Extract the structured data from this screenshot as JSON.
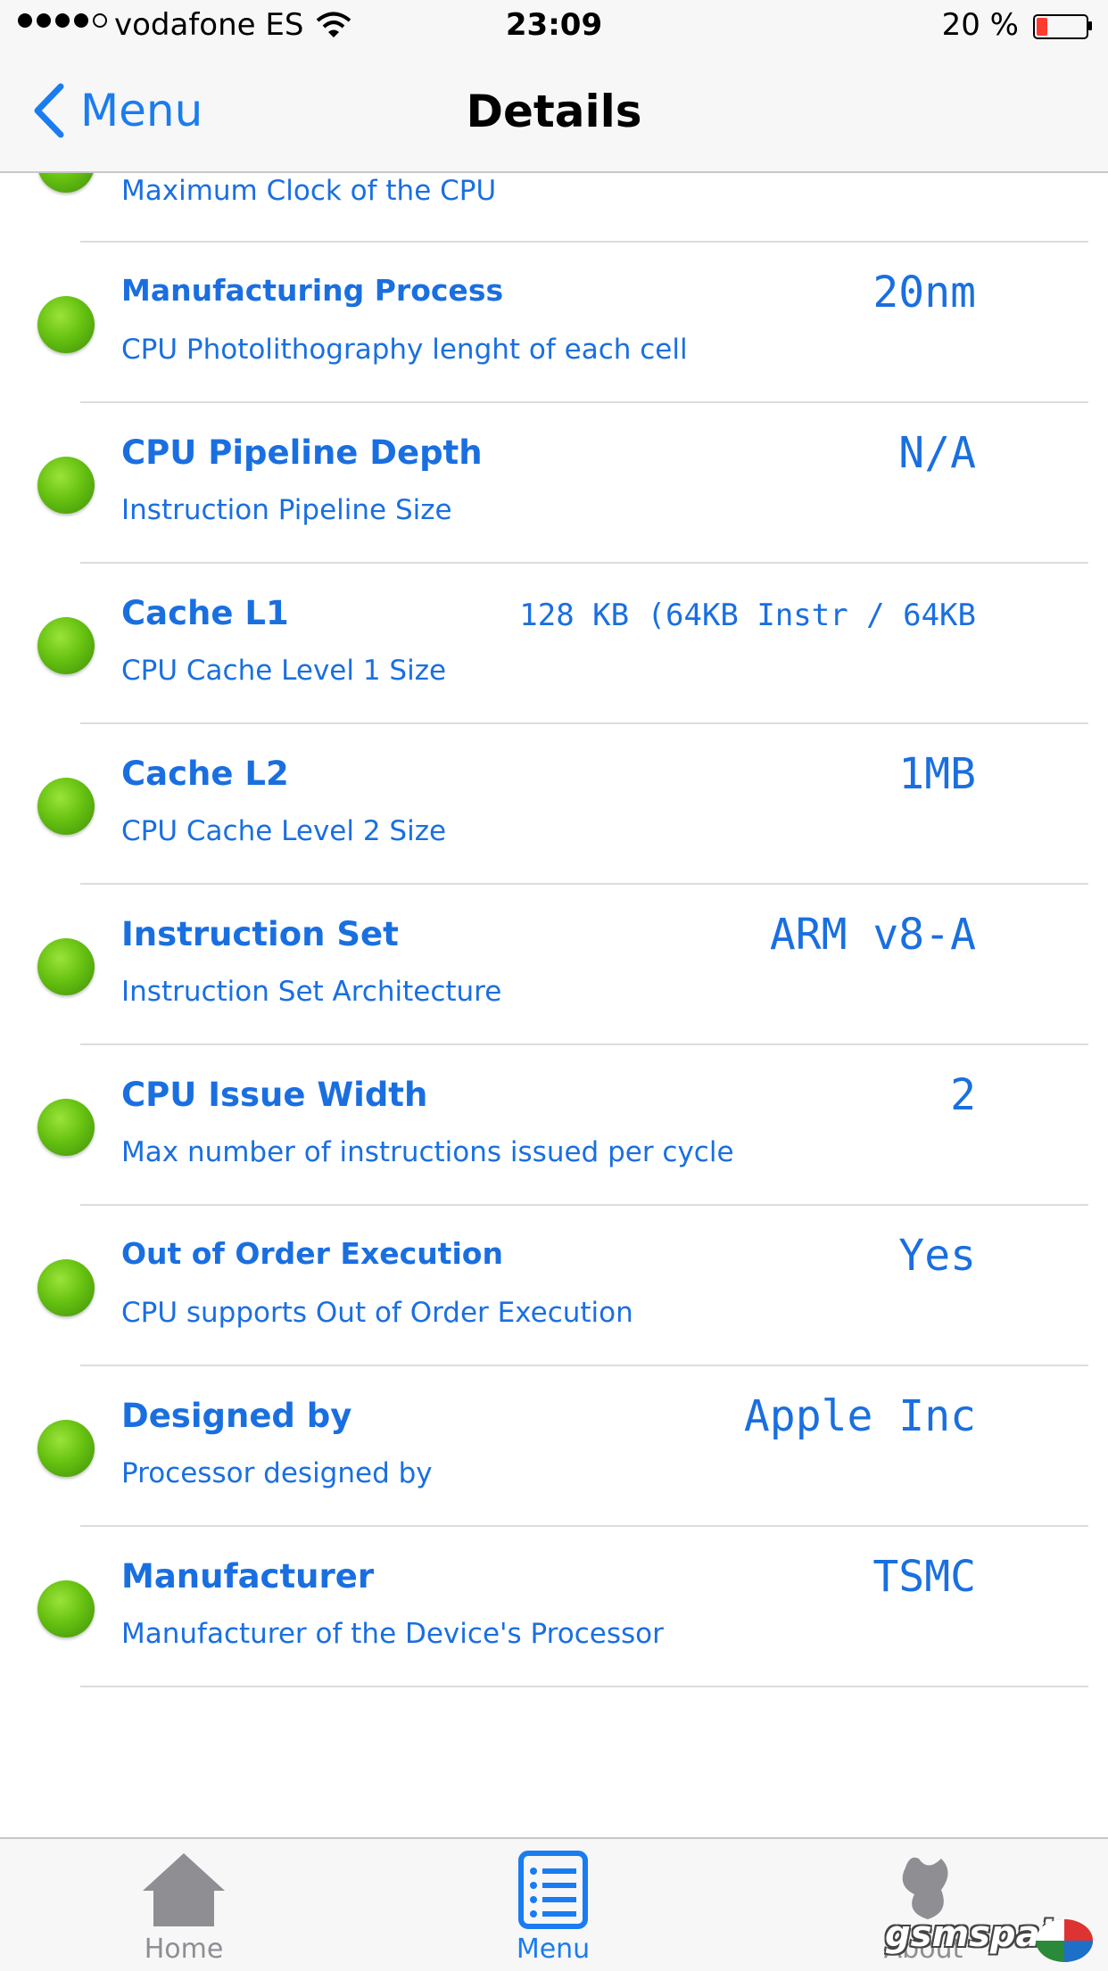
{
  "status_bar": {
    "carrier": "vodafone ES",
    "time": "23:09",
    "battery": "20 %"
  },
  "nav": {
    "back_label": "Menu",
    "title": "Details"
  },
  "partial_row": {
    "subtitle": "Maximum Clock of the CPU"
  },
  "rows": [
    {
      "title": "Manufacturing Process",
      "subtitle": "CPU Photolithography lenght of each cell",
      "value": "20nm"
    },
    {
      "title": "CPU Pipeline Depth",
      "subtitle": "Instruction Pipeline Size",
      "value": "N/A"
    },
    {
      "title": "Cache L1",
      "subtitle": "CPU Cache Level 1 Size",
      "value": "128 KB (64KB Instr / 64KB"
    },
    {
      "title": "Cache L2",
      "subtitle": "CPU Cache Level 2 Size",
      "value": "1MB"
    },
    {
      "title": "Instruction Set",
      "subtitle": "Instruction Set Architecture",
      "value": "ARM v8-A"
    },
    {
      "title": "CPU Issue Width",
      "subtitle": "Max number of instructions issued per cycle",
      "value": "2"
    },
    {
      "title": "Out of Order Execution",
      "subtitle": "CPU supports Out of Order Execution",
      "value": "Yes"
    },
    {
      "title": "Designed by",
      "subtitle": "Processor designed by",
      "value": "Apple Inc"
    },
    {
      "title": "Manufacturer",
      "subtitle": "Manufacturer of the Device's Processor",
      "value": "TSMC"
    }
  ],
  "tabs": [
    {
      "label": "Home",
      "icon": "home-icon"
    },
    {
      "label": "Menu",
      "icon": "list-icon"
    },
    {
      "label": "About",
      "icon": "about-icon"
    }
  ],
  "watermark": "gsmspain",
  "colors": {
    "accent": "#1a6fe0",
    "status_green": "#67c211",
    "battery_low": "#ff3b30"
  }
}
